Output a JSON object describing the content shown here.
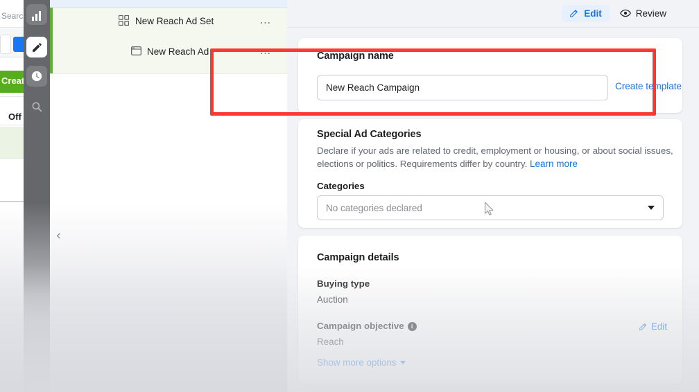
{
  "background_app": {
    "search_placeholder": "Searc",
    "create_button_label": "Creat",
    "column_header": "Off",
    "blue_button_icon": "blue-action-button",
    "white_box_icon": "input-box"
  },
  "icon_rail": {
    "items": [
      {
        "icon": "bar-chart-icon",
        "name": "rail-item-charts",
        "active": false
      },
      {
        "icon": "pencil-icon",
        "name": "rail-item-edit",
        "active": true
      },
      {
        "icon": "clock-icon",
        "name": "rail-item-history",
        "active": false
      },
      {
        "icon": "search-icon",
        "name": "rail-item-search",
        "active": false
      }
    ],
    "collapse_icon": "chevron-left-icon"
  },
  "list_panel": {
    "rows": [
      {
        "label": "New Reach Ad Set",
        "icon": "grid-squares-icon",
        "menu_icon": "ellipsis-icon"
      },
      {
        "label": "New Reach Ad",
        "icon": "ad-window-icon",
        "menu_icon": "ellipsis-icon"
      }
    ]
  },
  "header": {
    "tabs": [
      {
        "label": "Edit",
        "icon": "pencil-icon",
        "active": true
      },
      {
        "label": "Review",
        "icon": "eye-icon",
        "active": false
      }
    ]
  },
  "campaign_name_card": {
    "title": "Campaign name",
    "input_value": "New Reach Campaign",
    "input_placeholder": "Campaign name",
    "create_template_label": "Create template"
  },
  "special_ad_categories_card": {
    "title": "Special Ad Categories",
    "description": "Declare if your ads are related to credit, employment or housing, or about social issues, elections or politics. Requirements differ by country.",
    "learn_more_label": "Learn more",
    "categories_label": "Categories",
    "categories_value": "No categories declared",
    "dropdown_icon": "chevron-down-icon"
  },
  "campaign_details_card": {
    "title": "Campaign details",
    "buying_type_label": "Buying type",
    "buying_type_value": "Auction",
    "campaign_objective_label": "Campaign objective",
    "campaign_objective_info_icon": "info-icon",
    "campaign_objective_value": "Reach",
    "edit_label": "Edit",
    "edit_icon": "pencil-icon",
    "show_more_label": "Show more options",
    "show_more_icon": "caret-down-icon"
  },
  "annotation": {
    "highlight_color": "#fa3a32",
    "accent_blue": "#1b74e4",
    "rail_background": "#65676b",
    "list_accent_green": "#5fb22c"
  }
}
